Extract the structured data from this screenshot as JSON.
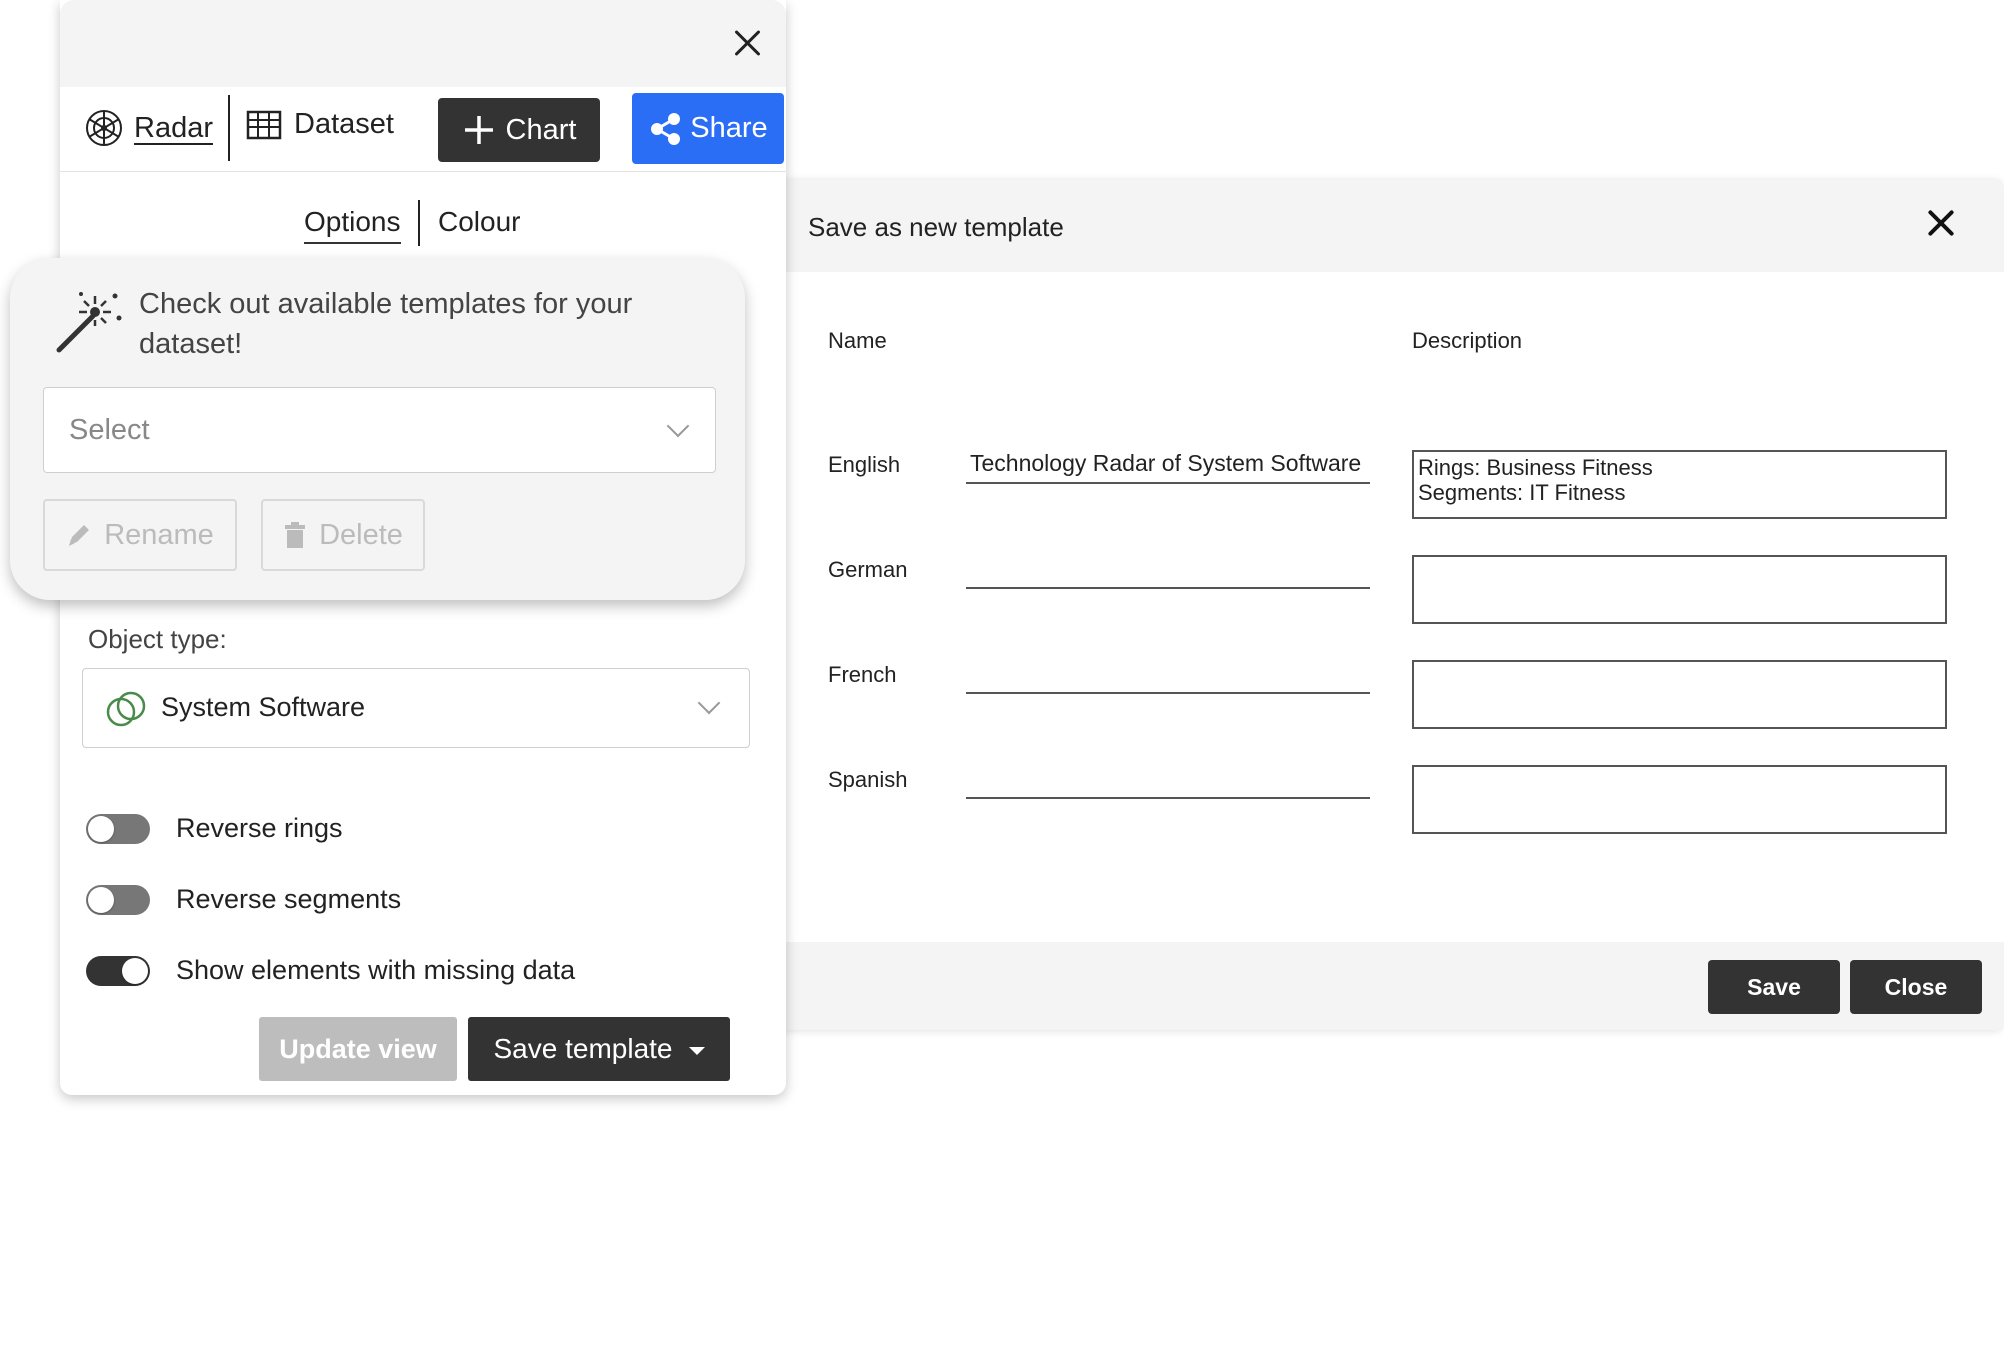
{
  "dialog": {
    "title": "Save as new template",
    "col_name": "Name",
    "col_description": "Description",
    "rows": [
      {
        "language": "English",
        "name": "Technology Radar of System Software",
        "description": "Rings: Business Fitness\nSegments: IT Fitness"
      },
      {
        "language": "German",
        "name": "",
        "description": ""
      },
      {
        "language": "French",
        "name": "",
        "description": ""
      },
      {
        "language": "Spanish",
        "name": "",
        "description": ""
      }
    ],
    "save_label": "Save",
    "close_label": "Close"
  },
  "panel": {
    "tabs": {
      "radar": "Radar",
      "dataset": "Dataset",
      "chart": "Chart",
      "share": "Share"
    },
    "subtabs": {
      "options": "Options",
      "colour": "Colour"
    },
    "templates": {
      "message": "Check out available templates for your dataset!",
      "select_placeholder": "Select",
      "rename_label": "Rename",
      "delete_label": "Delete"
    },
    "object_type_label": "Object type:",
    "object_type_value": "System Software",
    "toggles": [
      {
        "label": "Reverse rings",
        "on": false
      },
      {
        "label": "Reverse segments",
        "on": false
      },
      {
        "label": "Show elements with missing data",
        "on": true
      }
    ],
    "update_view_label": "Update view",
    "save_template_label": "Save template"
  },
  "colors": {
    "accent": "#2a6ef5",
    "dark_button": "#333333",
    "disabled_button": "#bdbdbd",
    "object_type_icon": "#4a8a4a"
  },
  "icons": {
    "radar": "radar-icon",
    "dataset": "table-icon",
    "chart": "plus-icon",
    "share": "share-icon",
    "magic": "magic-wand-icon",
    "rename": "pencil-icon",
    "delete": "trash-icon",
    "object_type": "object-type-circles-icon"
  }
}
